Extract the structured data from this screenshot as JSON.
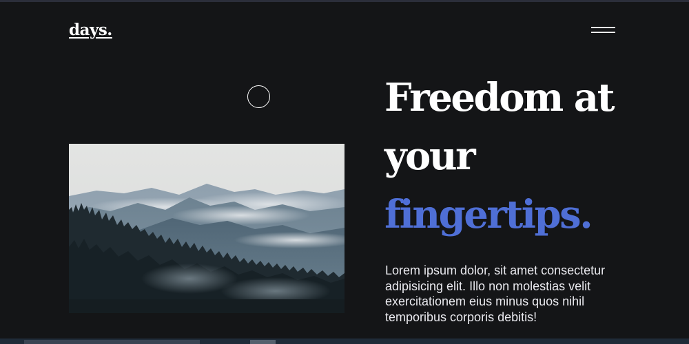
{
  "header": {
    "logo": "days."
  },
  "menu": {
    "icon": "hamburger-menu-icon"
  },
  "hero": {
    "image": "misty mountain forest photo",
    "headline_line1": "Freedom at",
    "headline_line2": "your",
    "headline_accent": "fingertips.",
    "body": "Lorem ipsum dolor, sit amet consectetur adipisicing elit. Illo non molestias velit exercitationem eius minus quos nihil temporibus corporis debitis!"
  },
  "colors": {
    "background": "#141517",
    "text": "#ffffff",
    "accent": "#4f6fd6"
  }
}
